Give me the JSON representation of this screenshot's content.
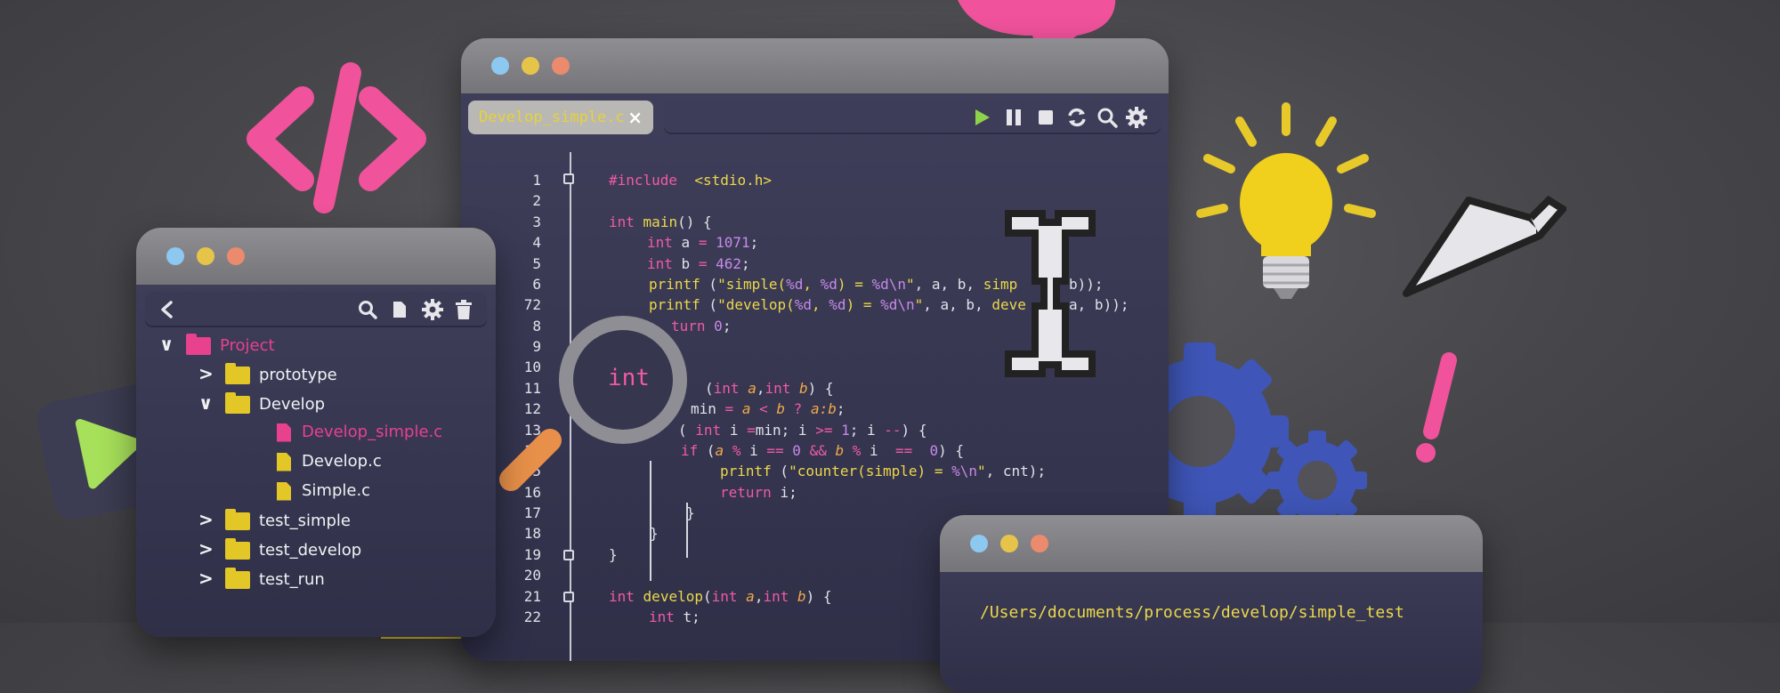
{
  "editor": {
    "tab_label": "Develop_simple.c",
    "tab_close": "×",
    "toolbar_icons": [
      "play-icon",
      "pause-icon",
      "stop-icon",
      "refresh-icon",
      "search-icon",
      "gear-icon"
    ],
    "lines": [
      {
        "num": "1"
      },
      {
        "num": "2"
      },
      {
        "num": "3"
      },
      {
        "num": "4"
      },
      {
        "num": "5"
      },
      {
        "num": "6"
      },
      {
        "num": "72"
      },
      {
        "num": "8"
      },
      {
        "num": "9"
      },
      {
        "num": "10"
      },
      {
        "num": "11"
      },
      {
        "num": "12"
      },
      {
        "num": "13"
      },
      {
        "num": "14"
      },
      {
        "num": "5"
      },
      {
        "num": "16"
      },
      {
        "num": "17"
      },
      {
        "num": "18"
      },
      {
        "num": "19"
      },
      {
        "num": "20"
      },
      {
        "num": "21"
      },
      {
        "num": "22"
      }
    ],
    "code": {
      "l1_include": "#include",
      "l1_header": "<stdio.h>",
      "l3_type": "int",
      "l3_fn": "main",
      "l3_rest": "() {",
      "l4_type": "int",
      "l4_a": "a",
      "l4_eq": "=",
      "l4_val": "1071",
      "l4_end": ";",
      "l5_type": "int",
      "l5_b": "b",
      "l5_eq": "=",
      "l5_val": "462",
      "l5_end": ";",
      "l6_fn": "printf",
      "l6_open": " (",
      "l6_str1": "\"simple(",
      "l6_fmt1": "%d",
      "l6_comma": ", ",
      "l6_fmt2": "%d",
      "l6_str2": ") = ",
      "l6_fmt3": "%d\\n",
      "l6_str3": "\"",
      "l6_args": ", a, b, ",
      "l6_call": "simp",
      "l6_tail": "b));",
      "l7_fn": "printf",
      "l7_open": " (",
      "l7_str1": "\"develop(",
      "l7_fmt1": "%d",
      "l7_comma": ", ",
      "l7_fmt2": "%d",
      "l7_str2": ") = ",
      "l7_fmt3": "%d\\n",
      "l7_str3": "\"",
      "l7_args": ", a, b, ",
      "l7_call": "deve",
      "l7_tail": "a, b));",
      "l8_kw": "turn",
      "l8_val": "0",
      "l8_end": ";",
      "l11_open": "(",
      "l11_t1": "int",
      "l11_a": "a",
      "l11_c": ",",
      "l11_t2": "int",
      "l11_b": "b",
      "l11_end": ") {",
      "l12_min": "min",
      "l12_eq": "=",
      "l12_a": "a",
      "l12_lt": "<",
      "l12_b": "b",
      "l12_q": "?",
      "l12_ab": "a:b",
      "l12_end": ";",
      "l13_open": "(",
      "l13_t": "int",
      "l13_i": "i",
      "l13_eq": "=",
      "l13_min": "min; i",
      "l13_ge": ">=",
      "l13_one": "1",
      "l13_mid": "; i",
      "l13_dec": "--",
      "l13_end": ") {",
      "l14_if": "if",
      "l14_open": " (",
      "l14_a": "a",
      "l14_mod1": "%",
      "l14_i1": "i",
      "l14_eq1": "==",
      "l14_z1": "0",
      "l14_and": "&&",
      "l14_b": "b",
      "l14_mod2": "%",
      "l14_i2": "i",
      "l14_eq2": "==",
      "l14_z2": "0",
      "l14_end": ") {",
      "l15_fn": "printf",
      "l15_open": " (",
      "l15_str1": "\"counter(simple) = ",
      "l15_fmt": "%\\n",
      "l15_str2": "\"",
      "l15_end": ", cnt);",
      "l16_ret": "return",
      "l16_end": "i;",
      "l17_close": "}",
      "l18_close": "}",
      "l19_close": "}",
      "l21_t": "int",
      "l21_fn": "develop",
      "l21_open": "(",
      "l21_t1": "int",
      "l21_a": "a",
      "l21_c": ",",
      "l21_t2": "int",
      "l21_b": "b",
      "l21_end": ") {",
      "l22_t": "int",
      "l22_v": "t;"
    }
  },
  "project": {
    "toolbar_icons": [
      "back-icon",
      "search-icon",
      "new-file-icon",
      "gear-icon",
      "trash-icon"
    ],
    "tree": [
      {
        "label": "Project",
        "chevron": "v",
        "kind": "folder-pink"
      },
      {
        "label": "prototype",
        "chevron": ">",
        "kind": "folder"
      },
      {
        "label": "Develop",
        "chevron": "v",
        "kind": "folder"
      },
      {
        "label": "Develop_simple.c",
        "kind": "file-pink"
      },
      {
        "label": "Develop.c",
        "kind": "file"
      },
      {
        "label": "Simple.c",
        "kind": "file"
      },
      {
        "label": "test_simple",
        "chevron": ">",
        "kind": "folder"
      },
      {
        "label": "test_develop",
        "chevron": ">",
        "kind": "folder"
      },
      {
        "label": "test_run",
        "chevron": ">",
        "kind": "folder"
      }
    ]
  },
  "terminal": {
    "path": "/Users/documents/process/develop/simple_test"
  },
  "magnifier": {
    "text": "int"
  },
  "colors": {
    "keyword": "#f05aa5",
    "function": "#ecd84a",
    "number": "#c88ae8",
    "accent_pink": "#e8418e",
    "accent_yellow": "#e3c727"
  }
}
